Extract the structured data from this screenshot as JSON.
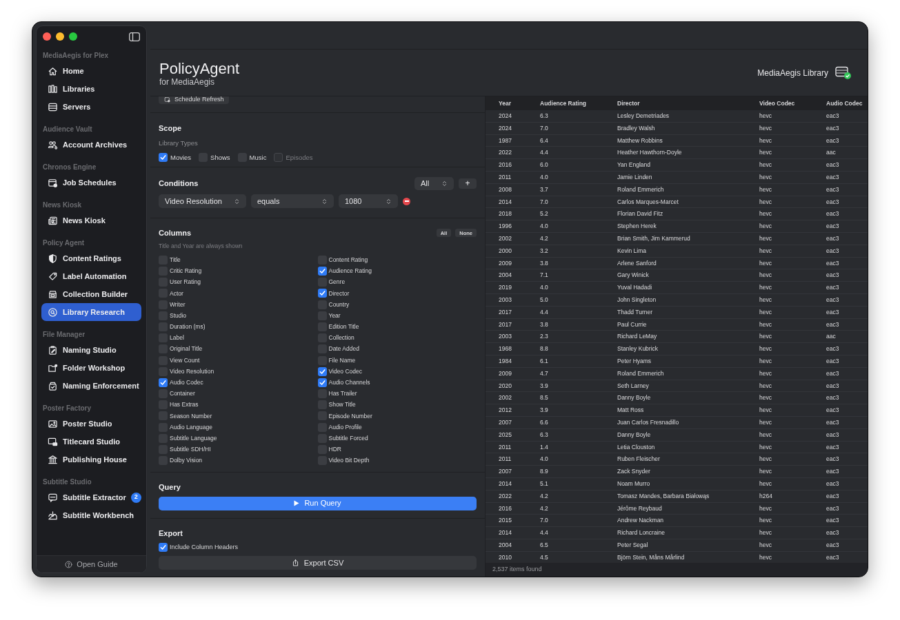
{
  "sidebar": {
    "sections": [
      {
        "title": "MediaAegis for Plex",
        "items": [
          {
            "label": "Home",
            "selected": false
          },
          {
            "label": "Libraries",
            "selected": false
          },
          {
            "label": "Servers",
            "selected": false
          }
        ]
      },
      {
        "title": "Audience Vault",
        "items": [
          {
            "label": "Account Archives",
            "selected": false
          }
        ]
      },
      {
        "title": "Chronos Engine",
        "items": [
          {
            "label": "Job Schedules",
            "selected": false
          }
        ]
      },
      {
        "title": "News Kiosk",
        "items": [
          {
            "label": "News Kiosk",
            "selected": false
          }
        ]
      },
      {
        "title": "Policy Agent",
        "items": [
          {
            "label": "Content Ratings",
            "selected": false
          },
          {
            "label": "Label Automation",
            "selected": false
          },
          {
            "label": "Collection Builder",
            "selected": false
          },
          {
            "label": "Library Research",
            "selected": true
          }
        ]
      },
      {
        "title": "File Manager",
        "items": [
          {
            "label": "Naming Studio",
            "selected": false
          },
          {
            "label": "Folder Workshop",
            "selected": false
          },
          {
            "label": "Naming Enforcement",
            "selected": false
          }
        ]
      },
      {
        "title": "Poster Factory",
        "items": [
          {
            "label": "Poster Studio",
            "selected": false
          },
          {
            "label": "Titlecard Studio",
            "selected": false
          },
          {
            "label": "Publishing House",
            "selected": false
          }
        ]
      },
      {
        "title": "Subtitle Studio",
        "items": [
          {
            "label": "Subtitle Extractor",
            "selected": false,
            "badge": "2"
          },
          {
            "label": "Subtitle Workbench",
            "selected": false
          }
        ]
      }
    ],
    "footer_button": "Open Guide"
  },
  "header": {
    "title": "PolicyAgent",
    "subtitle": "for MediaAegis",
    "library": "MediaAegis Library"
  },
  "panel": {
    "schedule_button": "Schedule Refresh",
    "scope": {
      "title": "Scope",
      "subtitle": "Library Types",
      "library_types": [
        {
          "label": "Movies",
          "checked": true,
          "disabled": false
        },
        {
          "label": "Shows",
          "checked": false,
          "disabled": false
        },
        {
          "label": "Music",
          "checked": false,
          "disabled": false
        },
        {
          "label": "Episodes",
          "checked": false,
          "disabled": true
        }
      ]
    },
    "conditions": {
      "title": "Conditions",
      "match": "All",
      "add_button": "+",
      "rows": [
        {
          "field": "Video Resolution",
          "operator": "equals",
          "value": "1080"
        }
      ]
    },
    "columns": {
      "title": "Columns",
      "hint": "Title and Year are always shown",
      "all_button": "All",
      "none_button": "None",
      "options": [
        {
          "label": "Title",
          "checked": false
        },
        {
          "label": "Critic Rating",
          "checked": false
        },
        {
          "label": "User Rating",
          "checked": false
        },
        {
          "label": "Actor",
          "checked": false
        },
        {
          "label": "Writer",
          "checked": false
        },
        {
          "label": "Studio",
          "checked": false
        },
        {
          "label": "Duration (ms)",
          "checked": false
        },
        {
          "label": "Label",
          "checked": false
        },
        {
          "label": "Original Title",
          "checked": false
        },
        {
          "label": "View Count",
          "checked": false
        },
        {
          "label": "Video Resolution",
          "checked": false
        },
        {
          "label": "Audio Codec",
          "checked": true
        },
        {
          "label": "Container",
          "checked": false
        },
        {
          "label": "Has Extras",
          "checked": false
        },
        {
          "label": "Season Number",
          "checked": false
        },
        {
          "label": "Audio Language",
          "checked": false
        },
        {
          "label": "Subtitle Language",
          "checked": false
        },
        {
          "label": "Subtitle SDH/HI",
          "checked": false
        },
        {
          "label": "Dolby Vision",
          "checked": false
        },
        {
          "label": "Content Rating",
          "checked": false
        },
        {
          "label": "Audience Rating",
          "checked": true
        },
        {
          "label": "Genre",
          "checked": false
        },
        {
          "label": "Director",
          "checked": true
        },
        {
          "label": "Country",
          "checked": false
        },
        {
          "label": "Year",
          "checked": false
        },
        {
          "label": "Edition Title",
          "checked": false
        },
        {
          "label": "Collection",
          "checked": false
        },
        {
          "label": "Date Added",
          "checked": false
        },
        {
          "label": "File Name",
          "checked": false
        },
        {
          "label": "Video Codec",
          "checked": true
        },
        {
          "label": "Audio Channels",
          "checked": true
        },
        {
          "label": "Has Trailer",
          "checked": false
        },
        {
          "label": "Show Title",
          "checked": false
        },
        {
          "label": "Episode Number",
          "checked": false
        },
        {
          "label": "Audio Profile",
          "checked": false
        },
        {
          "label": "Subtitle Forced",
          "checked": false
        },
        {
          "label": "HDR",
          "checked": false
        },
        {
          "label": "Video Bit Depth",
          "checked": false
        }
      ]
    },
    "query": {
      "title": "Query",
      "run_button": "Run Query"
    },
    "export": {
      "title": "Export",
      "include_headers": {
        "label": "Include Column Headers",
        "checked": true
      },
      "export_button": "Export CSV"
    }
  },
  "table": {
    "columns": [
      "Year",
      "Audience Rating",
      "Director",
      "Video Codec",
      "Audio Codec"
    ],
    "rows": [
      [
        "2024",
        "6.3",
        "Lesley Demetriades",
        "hevc",
        "eac3"
      ],
      [
        "2024",
        "7.0",
        "Bradley Walsh",
        "hevc",
        "eac3"
      ],
      [
        "1987",
        "6.4",
        "Matthew Robbins",
        "hevc",
        "eac3"
      ],
      [
        "2022",
        "4.4",
        "Heather Hawthorn-Doyle",
        "hevc",
        "aac"
      ],
      [
        "2016",
        "6.0",
        "Yan England",
        "hevc",
        "eac3"
      ],
      [
        "2011",
        "4.0",
        "Jamie Linden",
        "hevc",
        "eac3"
      ],
      [
        "2008",
        "3.7",
        "Roland Emmerich",
        "hevc",
        "eac3"
      ],
      [
        "2014",
        "7.0",
        "Carlos Marques-Marcet",
        "hevc",
        "eac3"
      ],
      [
        "2018",
        "5.2",
        "Florian David Fitz",
        "hevc",
        "eac3"
      ],
      [
        "1996",
        "4.0",
        "Stephen Herek",
        "hevc",
        "eac3"
      ],
      [
        "2002",
        "4.2",
        "Brian Smith, Jim Kammerud",
        "hevc",
        "eac3"
      ],
      [
        "2000",
        "3.2",
        "Kevin Lima",
        "hevc",
        "eac3"
      ],
      [
        "2009",
        "3.8",
        "Arlene Sanford",
        "hevc",
        "eac3"
      ],
      [
        "2004",
        "7.1",
        "Gary Winick",
        "hevc",
        "eac3"
      ],
      [
        "2019",
        "4.0",
        "Yuval Hadadi",
        "hevc",
        "eac3"
      ],
      [
        "2003",
        "5.0",
        "John Singleton",
        "hevc",
        "eac3"
      ],
      [
        "2017",
        "4.4",
        "Thadd Turner",
        "hevc",
        "eac3"
      ],
      [
        "2017",
        "3.8",
        "Paul Currie",
        "hevc",
        "eac3"
      ],
      [
        "2003",
        "2.3",
        "Richard LeMay",
        "hevc",
        "aac"
      ],
      [
        "1968",
        "8.8",
        "Stanley Kubrick",
        "hevc",
        "eac3"
      ],
      [
        "1984",
        "6.1",
        "Peter Hyams",
        "hevc",
        "eac3"
      ],
      [
        "2009",
        "4.7",
        "Roland Emmerich",
        "hevc",
        "eac3"
      ],
      [
        "2020",
        "3.9",
        "Seth Larney",
        "hevc",
        "eac3"
      ],
      [
        "2002",
        "8.5",
        "Danny Boyle",
        "hevc",
        "eac3"
      ],
      [
        "2012",
        "3.9",
        "Matt Ross",
        "hevc",
        "eac3"
      ],
      [
        "2007",
        "6.6",
        "Juan Carlos Fresnadillo",
        "hevc",
        "eac3"
      ],
      [
        "2025",
        "6.3",
        "Danny Boyle",
        "hevc",
        "eac3"
      ],
      [
        "2011",
        "1.4",
        "Letia Clouston",
        "hevc",
        "eac3"
      ],
      [
        "2011",
        "4.0",
        "Ruben Fleischer",
        "hevc",
        "eac3"
      ],
      [
        "2007",
        "8.9",
        "Zack Snyder",
        "hevc",
        "eac3"
      ],
      [
        "2014",
        "5.1",
        "Noam Murro",
        "hevc",
        "eac3"
      ],
      [
        "2022",
        "4.2",
        "Tomasz Mandes, Barbara Białowąs",
        "h264",
        "eac3"
      ],
      [
        "2016",
        "4.2",
        "Jérôme Reybaud",
        "hevc",
        "eac3"
      ],
      [
        "2015",
        "7.0",
        "Andrew Nackman",
        "hevc",
        "eac3"
      ],
      [
        "2014",
        "4.4",
        "Richard Loncraine",
        "hevc",
        "eac3"
      ],
      [
        "2004",
        "6.5",
        "Peter Segal",
        "hevc",
        "eac3"
      ],
      [
        "2010",
        "4.5",
        "Björn Stein, Måns Mårlind",
        "hevc",
        "eac3"
      ]
    ]
  },
  "status_bar": "2,537 items found"
}
